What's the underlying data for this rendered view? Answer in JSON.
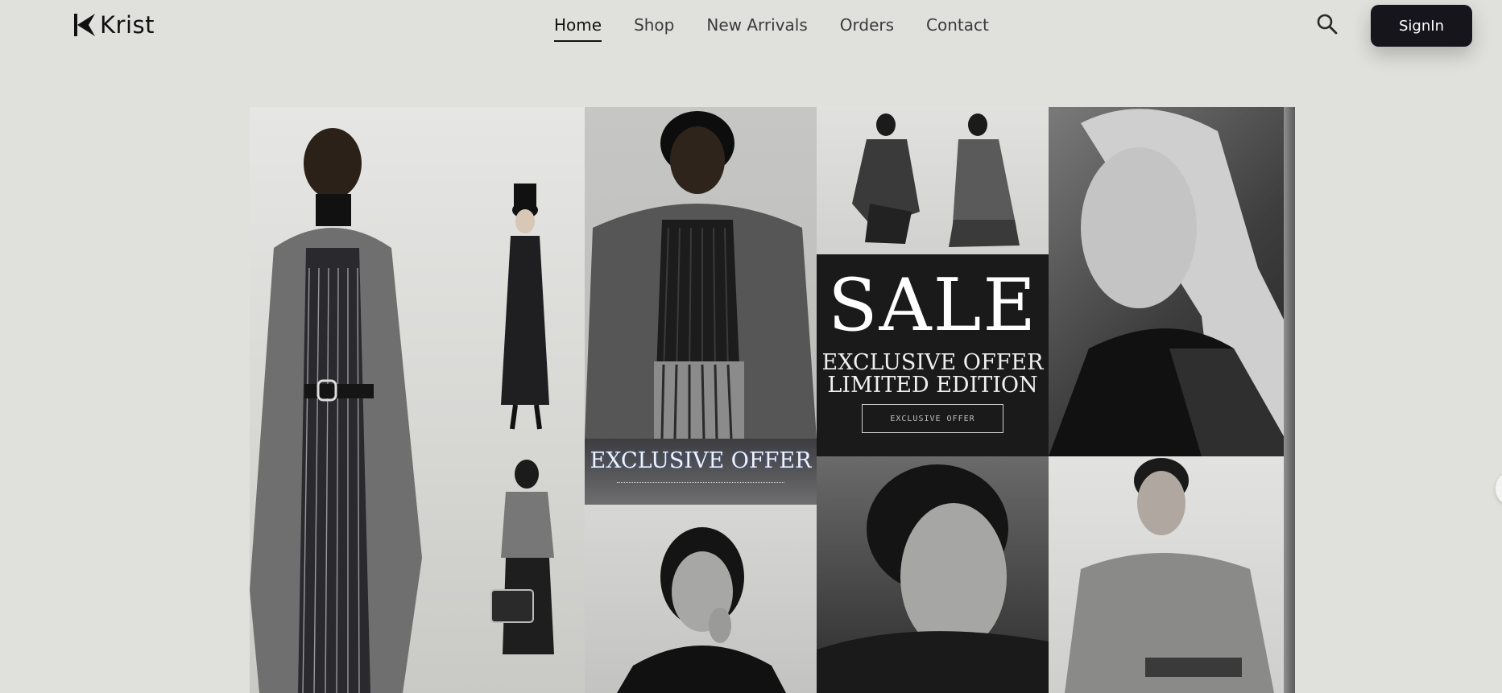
{
  "brand": {
    "name": "Krist"
  },
  "nav": {
    "items": [
      {
        "label": "Home",
        "active": true
      },
      {
        "label": "Shop",
        "active": false
      },
      {
        "label": "New Arrivals",
        "active": false
      },
      {
        "label": "Orders",
        "active": false
      },
      {
        "label": "Contact",
        "active": false
      }
    ]
  },
  "header": {
    "search_icon": "search-icon",
    "signin_label": "SignIn"
  },
  "hero": {
    "sale": {
      "title": "SALE",
      "line1": "EXCLUSIVE OFFER",
      "line2": "LIMITED EDITION",
      "cta": "EXCLUSIVE OFFER"
    },
    "banner": {
      "title": "EXCLUSIVE OFFER"
    }
  },
  "colors": {
    "page_background": "#e0e0dc",
    "signin_background": "#15151b",
    "text_primary": "#1b1b1f"
  }
}
